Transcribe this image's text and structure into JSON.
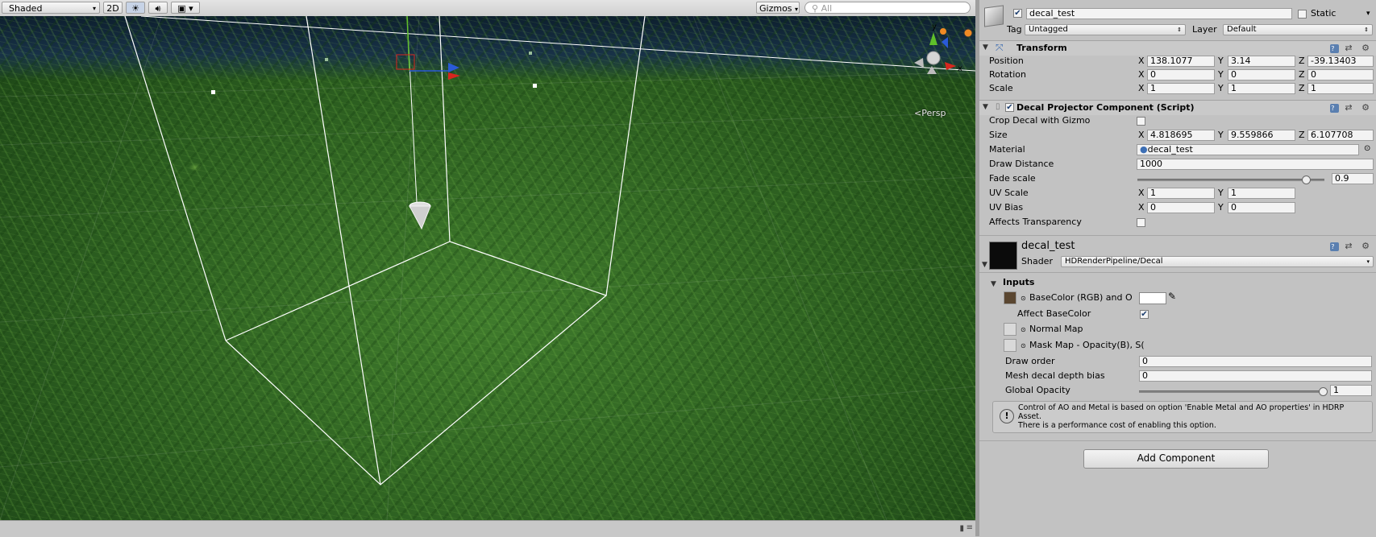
{
  "scene": {
    "toolbar": {
      "shading_mode": "Shaded",
      "btn_2d": "2D",
      "light_icon": "sun-icon",
      "audio_icon": "speaker-icon",
      "fx_icon": "image-icon",
      "gizmos": "Gizmos",
      "search_placeholder": "All"
    },
    "persp_label": "Persp",
    "gizmo_axes": {
      "y": "y",
      "x": "x"
    },
    "colors": {
      "axis_x": "#d7261e",
      "axis_y": "#5fbf2a",
      "axis_z": "#2a5ad7",
      "bounds_line": "#ffffff"
    }
  },
  "inspector": {
    "object": {
      "active": true,
      "name": "decal_test",
      "static_label": "Static",
      "static": false,
      "tag_label": "Tag",
      "tag_value": "Untagged",
      "layer_label": "Layer",
      "layer_value": "Default"
    },
    "transform": {
      "title": "Transform",
      "position_label": "Position",
      "rotation_label": "Rotation",
      "scale_label": "Scale",
      "position": {
        "x": "138.1077",
        "y": "3.14",
        "z": "-39.13403"
      },
      "rotation": {
        "x": "0",
        "y": "0",
        "z": "0"
      },
      "scale": {
        "x": "1",
        "y": "1",
        "z": "1"
      }
    },
    "decal_projector": {
      "title": "Decal Projector Component (Script)",
      "enabled": true,
      "crop_label": "Crop Decal with Gizmo",
      "crop": false,
      "size_label": "Size",
      "size": {
        "x": "4.818695",
        "y": "9.559866",
        "z": "6.107708"
      },
      "material_label": "Material",
      "material_value": "decal_test",
      "draw_distance_label": "Draw Distance",
      "draw_distance": "1000",
      "fade_scale_label": "Fade scale",
      "fade_scale": "0.9",
      "fade_scale_fraction": 0.9,
      "uv_scale_label": "UV Scale",
      "uv_scale": {
        "x": "1",
        "y": "1"
      },
      "uv_bias_label": "UV Bias",
      "uv_bias": {
        "x": "0",
        "y": "0"
      },
      "affects_transparency_label": "Affects Transparency",
      "affects_transparency": false
    },
    "material": {
      "name": "decal_test",
      "shader_label": "Shader",
      "shader_value": "HDRenderPipeline/Decal",
      "inputs_label": "Inputs",
      "base_color_label": "BaseColor (RGB) and O",
      "base_color_swatch": "#5a4630",
      "base_color_tint": "#ffffff",
      "affect_base_color_label": "Affect BaseColor",
      "affect_base_color": true,
      "normal_map_label": "Normal Map",
      "mask_map_label": "Mask Map - Opacity(B), S(",
      "draw_order_label": "Draw order",
      "draw_order": "0",
      "mesh_bias_label": "Mesh decal depth bias",
      "mesh_bias": "0",
      "global_opacity_label": "Global Opacity",
      "global_opacity": "1",
      "global_opacity_fraction": 1.0,
      "info_line1": "Control of AO and Metal is based on option 'Enable Metal and AO properties' in HDRP",
      "info_line2": "Asset.",
      "info_line3": "There is a performance cost of enabling this option."
    },
    "add_component": "Add Component"
  }
}
